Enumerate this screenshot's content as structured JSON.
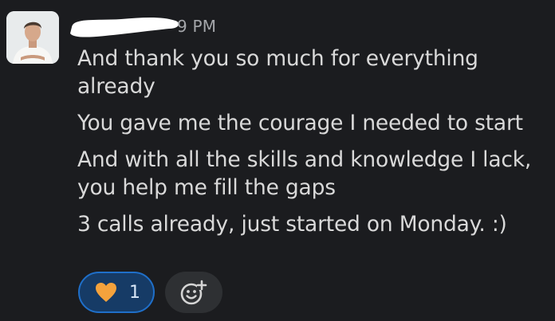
{
  "message": {
    "timestamp": "9 PM",
    "lines": [
      "And thank you so much for everything already",
      "You gave me the courage I needed to start",
      "And with all the skills and knowledge I lack, you help me fill the gaps",
      "3 calls already, just started on Monday. :)"
    ]
  },
  "reactions": [
    {
      "icon": "orange-heart-icon",
      "count": "1"
    }
  ],
  "add_reaction": {
    "icon": "add-reaction-icon"
  }
}
